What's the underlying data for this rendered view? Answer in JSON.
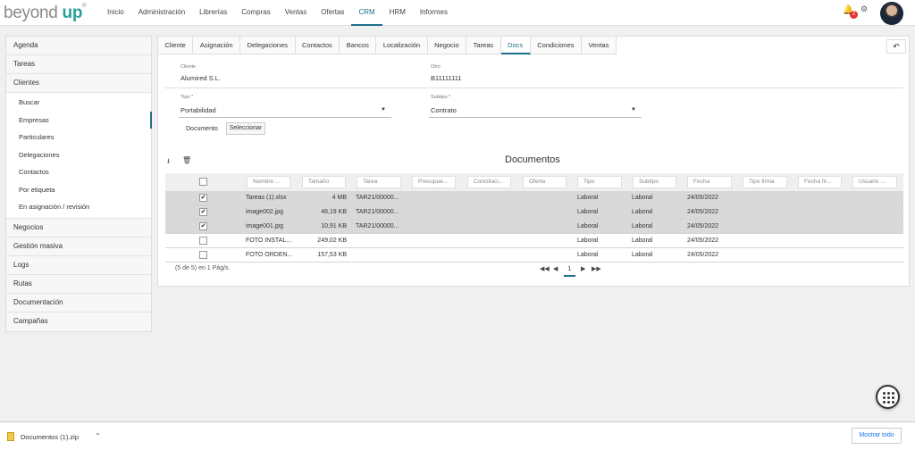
{
  "logo": {
    "main": "beyond",
    "accent": "up",
    "mark": "®"
  },
  "nav": [
    "Inicio",
    "Administración",
    "Librerías",
    "Compras",
    "Ventas",
    "Ofertas",
    "CRM",
    "HRM",
    "Informes"
  ],
  "header": {
    "notification_count": "2"
  },
  "sidebar": {
    "items": [
      "Agenda",
      "Tareas",
      "Clientes"
    ],
    "sub_items": [
      "Buscar",
      "Empresas",
      "Particulares",
      "Delegaciones",
      "Contactos",
      "Por etiqueta",
      "En asignación / revisión"
    ],
    "items_after": [
      "Negocios",
      "Gestión masiva",
      "Logs",
      "Rutas",
      "Documentación",
      "Campañas"
    ]
  },
  "tabs": [
    "Cliente",
    "Asignación",
    "Delegaciones",
    "Contactos",
    "Bancos",
    "Localización",
    "Negocio",
    "Tareas",
    "Docs",
    "Condiciones",
    "Ventas"
  ],
  "form": {
    "cliente_label": "Cliente",
    "cliente_value": "Alumired S.L.",
    "otro_label": "Otro",
    "otro_value": "B11111111",
    "tipo_label": "Tipo *",
    "tipo_value": "Portabilidad",
    "subtipo_label": "Subtipo *",
    "subtipo_value": "Contrato",
    "documento_label": "Documento",
    "select_button": "Seleccionar"
  },
  "documents": {
    "title": "Documentos",
    "filters": [
      "Nombre ...",
      "Tamaño",
      "Tarea",
      "Presupue...",
      "Conciliaci...",
      "Oferta",
      "Tipo",
      "Subtipo",
      "Fecha",
      "Tipo firma",
      "Fecha fir...",
      "Usuario ..."
    ],
    "rows": [
      {
        "checked": true,
        "name": "Tareas (1).xlsx",
        "size": "4 MB",
        "task": "TAR21/00000...",
        "type": "Laboral",
        "subtype": "Laboral",
        "date": "24/05/2022"
      },
      {
        "checked": true,
        "name": "image002.jpg",
        "size": "46,19 KB",
        "task": "TAR21/00000...",
        "type": "Laboral",
        "subtype": "Laboral",
        "date": "24/05/2022"
      },
      {
        "checked": true,
        "name": "image001.jpg",
        "size": "10,91 KB",
        "task": "TAR21/00000...",
        "type": "Laboral",
        "subtype": "Laboral",
        "date": "24/05/2022"
      },
      {
        "checked": false,
        "name": "FOTO INSTAL...",
        "size": "249,02 KB",
        "task": "",
        "type": "Laboral",
        "subtype": "Laboral",
        "date": "24/05/2022"
      },
      {
        "checked": false,
        "name": "FOTO ORDEN...",
        "size": "157,53 KB",
        "task": "",
        "type": "Laboral",
        "subtype": "Laboral",
        "date": "24/05/2022"
      }
    ],
    "pager_info": "(5 de 5) en 1 Pág/s.",
    "current_page": "1"
  },
  "download_bar": {
    "file_name": "Documentos (1).zip",
    "show_all": "Mostrar todo"
  },
  "colors": {
    "accent": "#1f6f8b",
    "brand": "#2aa39a",
    "selected_row": "#d9d9d9"
  }
}
